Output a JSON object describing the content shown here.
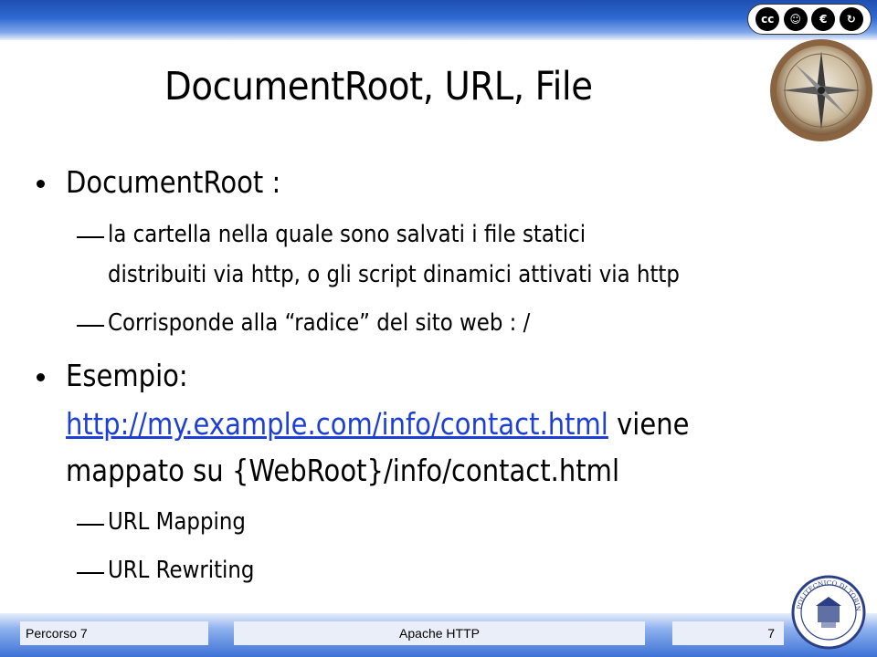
{
  "title": "DocumentRoot, URL, File",
  "bullets": [
    {
      "text": "DocumentRoot :",
      "sub": [
        {
          "lines": [
            "la cartella nella quale sono salvati i file statici",
            "distribuiti via http, o gli script dinamici attivati via http"
          ]
        },
        {
          "lines": [
            "Corrisponde alla “radice” del sito web : /"
          ]
        }
      ]
    },
    {
      "text": "Esempio:",
      "link": "http://my.example.com/info/contact.html",
      "after_link": " viene",
      "line3": "mappato su {WebRoot}/info/contact.html",
      "sub": [
        {
          "lines": [
            "URL Mapping"
          ]
        },
        {
          "lines": [
            "URL Rewriting"
          ]
        }
      ]
    }
  ],
  "footer": {
    "left": "Percorso 7",
    "center": "Apache HTTP",
    "page": "7"
  },
  "license_badge": {
    "symbols": [
      "cc",
      "by",
      "nc",
      "sa"
    ]
  },
  "seal_text": "POLITECNICO DI TORINO"
}
